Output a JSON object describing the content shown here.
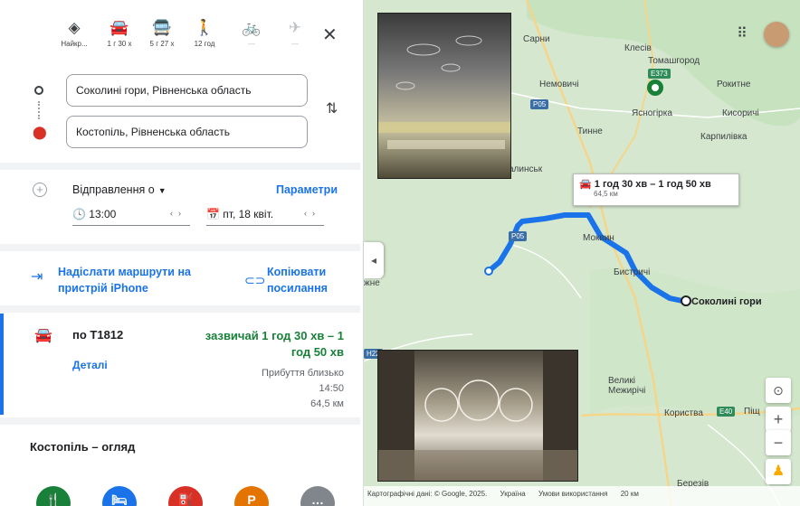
{
  "travel_modes": [
    {
      "icon": "best-route-icon",
      "label": "Найкр..."
    },
    {
      "icon": "car-icon",
      "label": "1 г 30 х"
    },
    {
      "icon": "transit-icon",
      "label": "5 г 27 х"
    },
    {
      "icon": "walk-icon",
      "label": "12 год"
    },
    {
      "icon": "bicycle-icon",
      "label": "—"
    },
    {
      "icon": "flight-icon",
      "label": "—"
    }
  ],
  "origin": "Соколині гори, Рівненська область",
  "destination": "Костопіль, Рівненська область",
  "depart_label": "Відправлення о",
  "params_label": "Параметри",
  "time_value": "13:00",
  "date_value": "пт, 18 квіт.",
  "send_label": "Надіслати маршрути на пристрій iPhone",
  "copy_label": "Копіювати посилання",
  "route": {
    "via": "по Т1812",
    "usual_time": "зазвичай 1 год 30 хв – 1 год 50 хв",
    "details": "Деталі",
    "arrival_label": "Прибуття близько",
    "arrival_time": "14:50",
    "distance": "64,5 км"
  },
  "overview_title": "Костопіль – огляд",
  "map": {
    "route_box_time": "1 год 30 хв – 1 год 50 хв",
    "route_box_dist": "64,5 км",
    "dest_label": "Соколині гори",
    "places": [
      "Сарни",
      "Клесів",
      "Томашгород",
      "Рокитне",
      "Немовичі",
      "Ясногірка",
      "Кисоричі",
      "Тинне",
      "Карпилівка",
      "алинськ",
      "Моквин",
      "Бистричі",
      "Великі Межирічі",
      "Користва",
      "Піщ",
      "Березів",
      "жне"
    ],
    "roads": [
      "E373",
      "P05",
      "P05",
      "E40",
      "H22"
    ],
    "footer": [
      "Картографічні дані: © Google, 2025.",
      "Україна",
      "Умови використання",
      "20 км"
    ]
  },
  "poi_colors": [
    "#188038",
    "#1a73e8",
    "#d93025",
    "#e37400",
    "#80868b"
  ],
  "colors": {
    "accent": "#1a73e8",
    "route": "#1a73e8",
    "green": "#188038"
  }
}
